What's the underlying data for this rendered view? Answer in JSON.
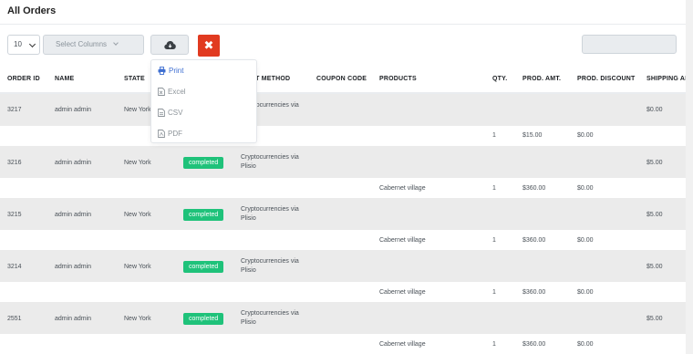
{
  "page": {
    "title": "All Orders"
  },
  "toolbar": {
    "length_value": "10",
    "columns_placeholder": "Select Columns",
    "export_icon": "cloud-download-icon",
    "clear_icon": "close-icon",
    "search_value": ""
  },
  "export_menu": {
    "items": [
      {
        "label": "Print",
        "icon": "print-icon"
      },
      {
        "label": "Excel",
        "icon": "excel-file-icon"
      },
      {
        "label": "CSV",
        "icon": "csv-file-icon"
      },
      {
        "label": "PDF",
        "icon": "pdf-file-icon"
      }
    ]
  },
  "table": {
    "columns": [
      "ORDER ID",
      "NAME",
      "STATE",
      "",
      "ENT METHOD",
      "COUPON CODE",
      "PRODUCTS",
      "QTY.",
      "PROD. AMT.",
      "PROD. DISCOUNT",
      "SHIPPING AI"
    ],
    "orders": [
      {
        "order_id": "3217",
        "name": "admin admin",
        "state": "New York",
        "status": "",
        "payment": "Cryptocurrencies via",
        "shipping": "$0.00",
        "line": {
          "product": "",
          "qty": "1",
          "amount": "$15.00",
          "discount": "$0.00"
        }
      },
      {
        "order_id": "3216",
        "name": "admin admin",
        "state": "New York",
        "status": "completed",
        "payment": "Cryptocurrencies via Plisio",
        "shipping": "$5.00",
        "line": {
          "product": "Cabernet village",
          "qty": "1",
          "amount": "$360.00",
          "discount": "$0.00"
        }
      },
      {
        "order_id": "3215",
        "name": "admin admin",
        "state": "New York",
        "status": "completed",
        "payment": "Cryptocurrencies via Plisio",
        "shipping": "$5.00",
        "line": {
          "product": "Cabernet village",
          "qty": "1",
          "amount": "$360.00",
          "discount": "$0.00"
        }
      },
      {
        "order_id": "3214",
        "name": "admin admin",
        "state": "New York",
        "status": "completed",
        "payment": "Cryptocurrencies via Plisio",
        "shipping": "$5.00",
        "line": {
          "product": "Cabernet village",
          "qty": "1",
          "amount": "$360.00",
          "discount": "$0.00"
        }
      },
      {
        "order_id": "2551",
        "name": "admin admin",
        "state": "New York",
        "status": "completed",
        "payment": "Cryptocurrencies via Plisio",
        "shipping": "$5.00",
        "line": {
          "product": "Cabernet village",
          "qty": "1",
          "amount": "$360.00",
          "discount": "$0.00"
        }
      }
    ]
  },
  "colors": {
    "status_completed": "#1fc27a",
    "clear_button": "#e13a20",
    "menu_active": "#3f6fd1",
    "row_main_bg": "#ebebeb"
  }
}
